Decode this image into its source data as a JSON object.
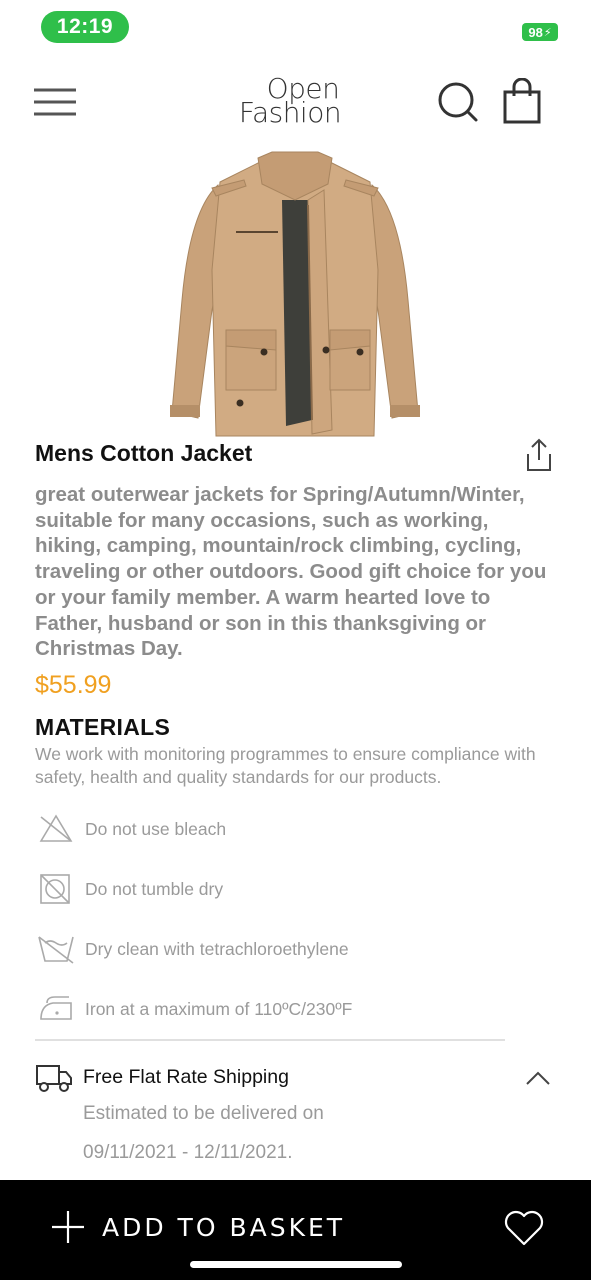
{
  "status": {
    "time": "12:19",
    "battery": "98",
    "accent_color": "#2fbf4a"
  },
  "header": {
    "logo_line1": "Open",
    "logo_line2": "Fashion",
    "icons": [
      "menu-icon",
      "search-icon",
      "shopping-bag-icon"
    ]
  },
  "product": {
    "title": "Mens Cotton Jacket",
    "description": "great outerwear jackets for Spring/Autumn/Winter, suitable for many occasions, such as working, hiking, camping, mountain/rock climbing, cycling, traveling or other outdoors. Good gift choice for you or your family member. A warm hearted love to Father, husband or son in this thanksgiving or Christmas Day.",
    "price": "$55.99",
    "price_color": "#f0a020"
  },
  "materials": {
    "heading": "MATERIALS",
    "text": "We work with monitoring programmes to ensure compliance with safety, health and quality standards for our products.",
    "care": [
      {
        "icon": "no-bleach-icon",
        "label": "Do not use bleach"
      },
      {
        "icon": "no-tumble-dry-icon",
        "label": "Do not tumble dry"
      },
      {
        "icon": "dry-clean-icon",
        "label": "Dry clean with tetrachloroethylene"
      },
      {
        "icon": "iron-icon",
        "label": "Iron at a maximum of 110ºC/230ºF"
      }
    ]
  },
  "shipping": {
    "title": "Free Flat Rate Shipping",
    "estimate": "Estimated to be delivered on",
    "dates": "09/11/2021 - 12/11/2021."
  },
  "bottom_bar": {
    "add_label": "ADD TO BASKET"
  }
}
